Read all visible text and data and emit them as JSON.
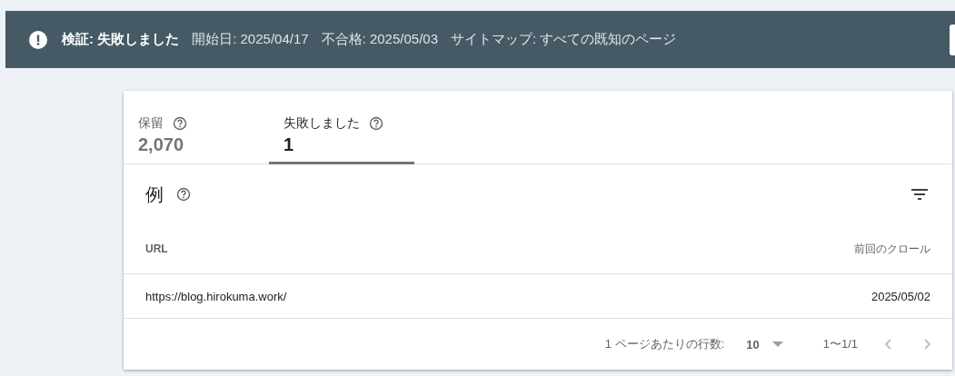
{
  "banner": {
    "title": "検証: 失敗しました",
    "details": [
      "開始日: 2025/04/17",
      "不合格: 2025/05/03",
      "サイトマップ: すべての既知のページ"
    ]
  },
  "tabs": [
    {
      "label": "保留",
      "count": "2,070",
      "selected": false
    },
    {
      "label": "失敗しました",
      "count": "1",
      "selected": true
    }
  ],
  "section": {
    "title": "例"
  },
  "table": {
    "columns": [
      "URL",
      "前回のクロール"
    ],
    "rows": [
      [
        "https://blog.hirokuma.work/",
        "2025/05/02"
      ]
    ]
  },
  "pagination": {
    "rows_label": "1 ページあたりの行数:",
    "rows_value": "10",
    "range": "1〜1/1",
    "prev_disabled": true,
    "next_disabled": true
  }
}
